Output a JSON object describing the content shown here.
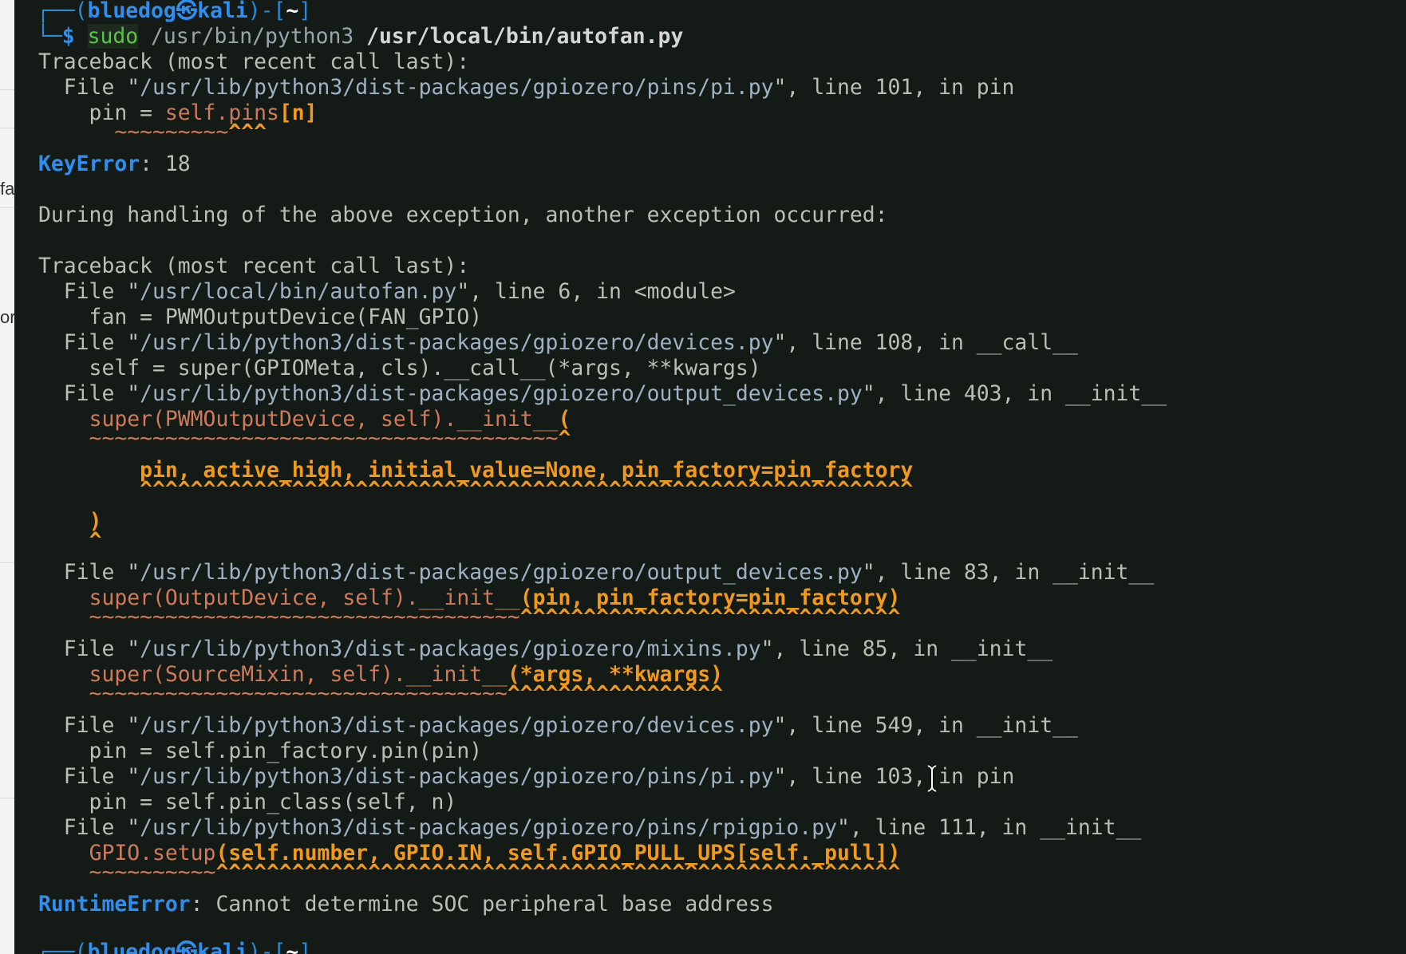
{
  "left_strip": {
    "fragment_1": "fa",
    "fragment_2": "or"
  },
  "prompt_top": {
    "corner": "┌──(",
    "user": "bluedog",
    "at": "㉿",
    "host": "kali",
    "close": ")-[",
    "dir": "~",
    "end": "]",
    "corner2": "└─",
    "dollar": "$ ",
    "cmd": "sudo",
    "arg1": " /usr/bin/python3 ",
    "arg2": "/usr/local/bin/autofan.py"
  },
  "lines": {
    "tb1": "Traceback (most recent call last):",
    "f1_a": "  File \"",
    "f1_path": "/usr/lib/python3/dist-packages/gpiozero/pins/pi.py",
    "f1_b": "\", line 101, in pin",
    "c1_a": "    pin = ",
    "c1_err": "self.pins",
    "c1_hi": "[n]",
    "u1_t": "      ~~~~~~~~~",
    "u1_c": "^^^",
    "ke_name": "KeyError",
    "ke_msg": ": 18",
    "during": "During handling of the above exception, another exception occurred:",
    "tb2": "Traceback (most recent call last):",
    "f2_a": "  File \"",
    "f2_path": "/usr/local/bin/autofan.py",
    "f2_b": "\", line 6, in <module>",
    "c2": "    fan = PWMOutputDevice(FAN_GPIO)",
    "f3_a": "  File \"",
    "f3_path": "/usr/lib/python3/dist-packages/gpiozero/devices.py",
    "f3_b": "\", line 108, in __call__",
    "c3": "    self = super(GPIOMeta, cls).__call__(*args, **kwargs)",
    "f4_a": "  File \"",
    "f4_path": "/usr/lib/python3/dist-packages/gpiozero/output_devices.py",
    "f4_b": "\", line 403, in __init__",
    "c4_a": "    ",
    "c4_err": "super(PWMOutputDevice, self).__init__",
    "c4_hi": "(",
    "u4_t": "    ~~~~~~~~~~~~~~~~~~~~~~~~~~~~~~~~~~~~~",
    "u4_c": "^",
    "c5_a": "        ",
    "c5_hi": "pin, active_high, initial_value=None, pin_factory=pin_factory",
    "u5_a": "        ",
    "u5_c": "^^^^^^^^^^^^^^^^^^^^^^^^^^^^^^^^^^^^^^^^^^^^^^^^^^^^^^^^^^^^^",
    "c6_a": "    ",
    "c6_hi": ")",
    "u6_a": "    ",
    "u6_c": "^",
    "f5_a": "  File \"",
    "f5_path": "/usr/lib/python3/dist-packages/gpiozero/output_devices.py",
    "f5_b": "\", line 83, in __init__",
    "c7_a": "    ",
    "c7_err": "super(OutputDevice, self).__init__",
    "c7_hi": "(pin, pin_factory=pin_factory)",
    "u7_t": "    ~~~~~~~~~~~~~~~~~~~~~~~~~~~~~~~~~~",
    "u7_c": "^^^^^^^^^^^^^^^^^^^^^^^^^^^^^^",
    "f6_a": "  File \"",
    "f6_path": "/usr/lib/python3/dist-packages/gpiozero/mixins.py",
    "f6_b": "\", line 85, in __init__",
    "c8_a": "    ",
    "c8_err": "super(SourceMixin, self).__init__",
    "c8_hi": "(*args, **kwargs)",
    "u8_t": "    ~~~~~~~~~~~~~~~~~~~~~~~~~~~~~~~~~",
    "u8_c": "^^^^^^^^^^^^^^^^^",
    "f7_a": "  File \"",
    "f7_path": "/usr/lib/python3/dist-packages/gpiozero/devices.py",
    "f7_b": "\", line 549, in __init__",
    "c9": "    pin = self.pin_factory.pin(pin)",
    "f8_a": "  File \"",
    "f8_path": "/usr/lib/python3/dist-packages/gpiozero/pins/pi.py",
    "f8_b": "\", line 103, in pin",
    "c10": "    pin = self.pin_class(self, n)",
    "f9_a": "  File \"",
    "f9_path": "/usr/lib/python3/dist-packages/gpiozero/pins/rpigpio.py",
    "f9_b": "\", line 111, in __init__",
    "c11_a": "    ",
    "c11_err": "GPIO.setup",
    "c11_hi": "(self.number, GPIO.IN, self.GPIO_PULL_UPS[self._pull])",
    "u11_t": "    ~~~~~~~~~~",
    "u11_c": "^^^^^^^^^^^^^^^^^^^^^^^^^^^^^^^^^^^^^^^^^^^^^^^^^^^^^^",
    "re_name": "RuntimeError",
    "re_msg": ": Cannot determine SOC peripheral base address"
  },
  "prompt_bottom": {
    "corner": "┌──(",
    "user": "bluedog",
    "at": "㉿",
    "host": "kali",
    "close": ")-[",
    "dir": "~",
    "end": "]"
  },
  "colors": {
    "terminal_bg": "#141a15",
    "prompt_blue": "#2f8ff0",
    "command_green": "#59c34c",
    "error_orange": "#f29a17",
    "error_red": "#cf7a5b"
  }
}
